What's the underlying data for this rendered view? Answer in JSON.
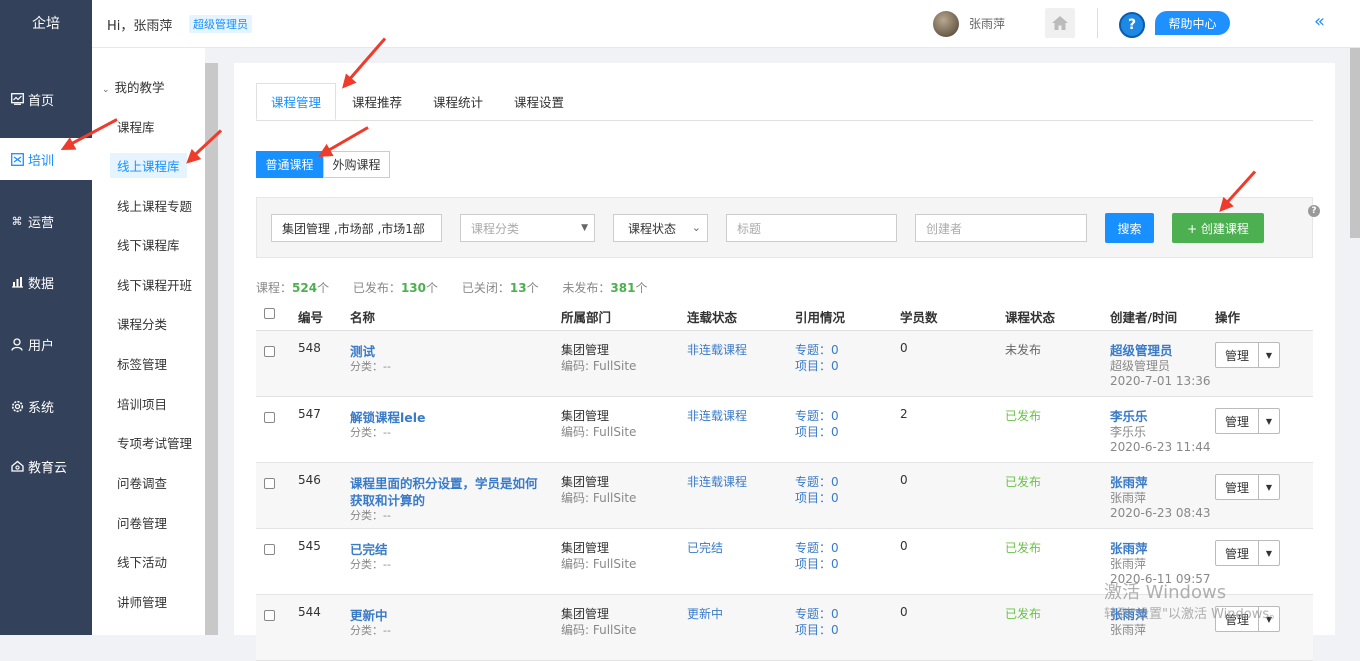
{
  "app": {
    "logo": "企培"
  },
  "leftnav": [
    {
      "label": "首页",
      "icon": "dashboard-icon"
    },
    {
      "label": "培训",
      "icon": "book-icon"
    },
    {
      "label": "运营",
      "icon": "command-icon"
    },
    {
      "label": "数据",
      "icon": "chart-icon"
    },
    {
      "label": "用户",
      "icon": "user-icon"
    },
    {
      "label": "系统",
      "icon": "gear-icon"
    },
    {
      "label": "教育云",
      "icon": "cloud-icon"
    }
  ],
  "header": {
    "greeting": "Hi，张雨萍",
    "role": "超级管理员",
    "username": "张雨萍",
    "help": "帮助中心",
    "help_q": "?"
  },
  "subnav": {
    "group": "我的教学",
    "items": [
      "课程库",
      "线上课程库",
      "线上课程专题",
      "线下课程库",
      "线下课程开班",
      "课程分类",
      "标签管理",
      "培训项目",
      "专项考试管理",
      "问卷调查",
      "问卷管理",
      "线下活动",
      "讲师管理"
    ]
  },
  "tabs": [
    "课程管理",
    "课程推荐",
    "课程统计",
    "课程设置"
  ],
  "segments": [
    "普通课程",
    "外购课程"
  ],
  "filter": {
    "dept": "集团管理 ,市场部 ,市场1部",
    "category_ph": "课程分类",
    "status": "课程状态",
    "title_ph": "标题",
    "creator_ph": "创建者",
    "search": "搜索",
    "create": "+ 创建课程",
    "help": "?"
  },
  "stats": {
    "course_label": "课程：",
    "course": "524",
    "unit": "个",
    "published_label": "已发布：",
    "published": "130",
    "closed_label": "已关闭：",
    "closed": "13",
    "unpublished_label": "未发布：",
    "unpublished": "381"
  },
  "table": {
    "headers": [
      "编号",
      "名称",
      "所属部门",
      "连载状态",
      "引用情况",
      "学员数",
      "课程状态",
      "创建者/时间",
      "操作"
    ],
    "rows": [
      {
        "id": "548",
        "name": "测试",
        "name2": "",
        "category": "分类：--",
        "dept": "集团管理",
        "code": "编码: FullSite",
        "serial": "非连载课程",
        "topic": "专题：0",
        "project": "项目：0",
        "students": "0",
        "status": "未发布",
        "creator": "超级管理员",
        "creator_sub": "超级管理员",
        "time": "2020-7-01 13:36",
        "action": "管理"
      },
      {
        "id": "547",
        "name": "解锁课程lele",
        "name2": "",
        "category": "分类：--",
        "dept": "集团管理",
        "code": "编码: FullSite",
        "serial": "非连载课程",
        "topic": "专题：0",
        "project": "项目：0",
        "students": "2",
        "status": "已发布",
        "creator": "李乐乐",
        "creator_sub": "李乐乐",
        "time": "2020-6-23 11:44",
        "action": "管理"
      },
      {
        "id": "546",
        "name": "课程里面的积分设置，学员是如何",
        "name2": "获取和计算的",
        "category": "分类：--",
        "dept": "集团管理",
        "code": "编码: FullSite",
        "serial": "非连载课程",
        "topic": "专题：0",
        "project": "项目：0",
        "students": "0",
        "status": "已发布",
        "creator": "张雨萍",
        "creator_sub": "张雨萍",
        "time": "2020-6-23 08:43",
        "action": "管理"
      },
      {
        "id": "545",
        "name": "已完结",
        "name2": "",
        "category": "分类：--",
        "dept": "集团管理",
        "code": "编码: FullSite",
        "serial": "已完结",
        "topic": "专题：0",
        "project": "项目：0",
        "students": "0",
        "status": "已发布",
        "creator": "张雨萍",
        "creator_sub": "张雨萍",
        "time": "2020-6-11 09:57",
        "action": "管理"
      },
      {
        "id": "544",
        "name": "更新中",
        "name2": "",
        "category": "分类：--",
        "dept": "集团管理",
        "code": "编码: FullSite",
        "serial": "更新中",
        "topic": "专题：0",
        "project": "项目：0",
        "students": "0",
        "status": "已发布",
        "creator": "张雨萍",
        "creator_sub": "张雨萍",
        "time": "",
        "action": "管理"
      }
    ]
  },
  "watermark": {
    "line1": "激活 Windows",
    "line2": "转到\"设置\"以激活 Windows。"
  },
  "colors": {
    "nav_bg": "#33415a",
    "primary": "#1890ff",
    "success": "#4caf50",
    "annotation": "#ee3b2b"
  }
}
